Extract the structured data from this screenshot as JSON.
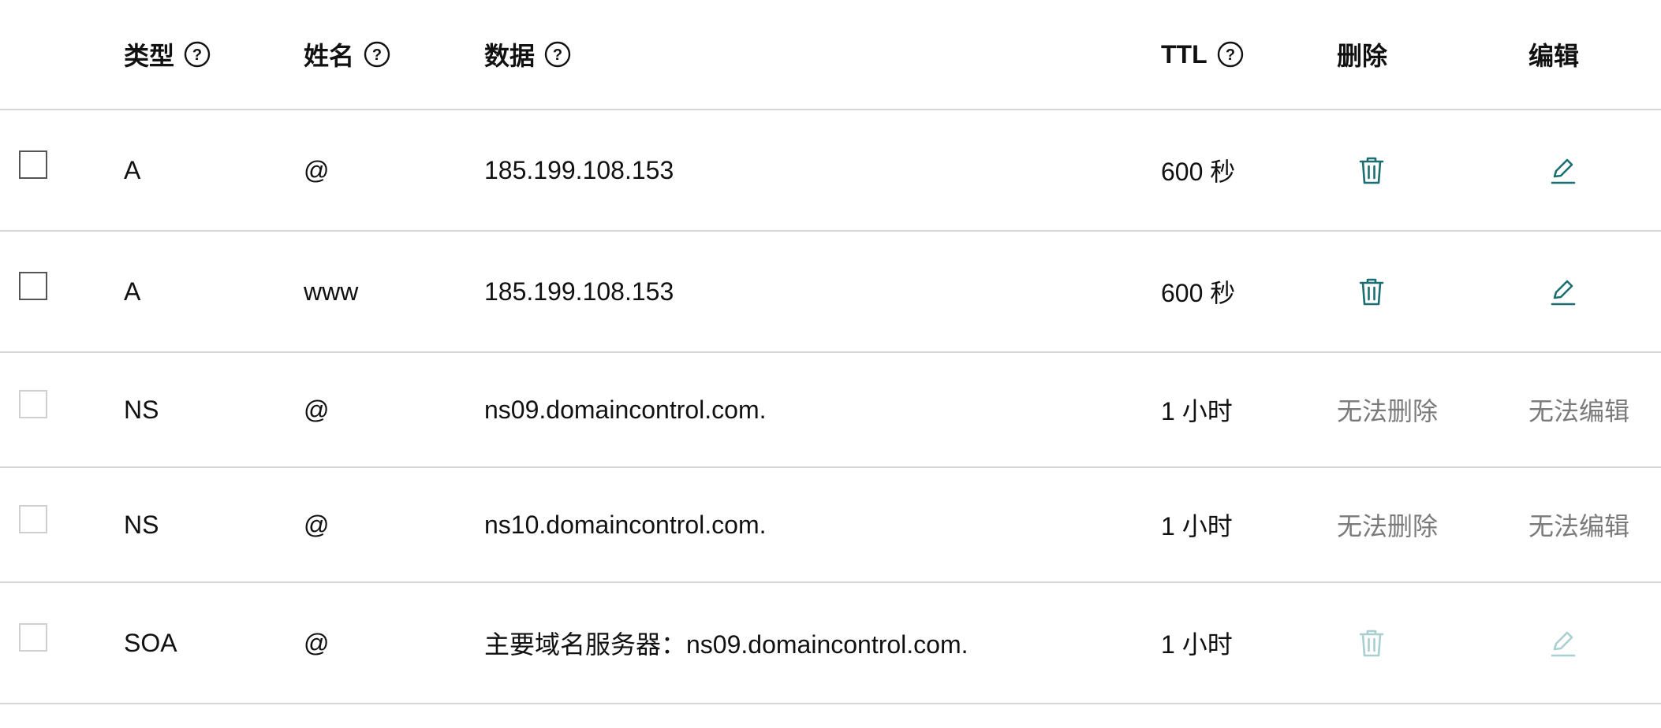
{
  "colors": {
    "accent": "#1b6e72",
    "accent_disabled": "#a9cfd0",
    "divider": "#d6d6d6",
    "disabled_text": "#7a7a7a"
  },
  "header": {
    "type": "类型",
    "name": "姓名",
    "data": "数据",
    "ttl": "TTL",
    "delete": "删除",
    "edit": "编辑"
  },
  "rows": [
    {
      "type": "A",
      "name": "@",
      "data": "185.199.108.153",
      "ttl": "600 秒",
      "delete": "trash-icon",
      "edit": "pencil-icon",
      "selectable": true,
      "editable": true
    },
    {
      "type": "A",
      "name": "www",
      "data": "185.199.108.153",
      "ttl": "600 秒",
      "delete": "trash-icon",
      "edit": "pencil-icon",
      "selectable": true,
      "editable": true
    },
    {
      "type": "NS",
      "name": "@",
      "data": "ns09.domaincontrol.com.",
      "ttl": "1 小时",
      "delete_text": "无法删除",
      "edit_text": "无法编辑",
      "selectable": false,
      "editable": false
    },
    {
      "type": "NS",
      "name": "@",
      "data": "ns10.domaincontrol.com.",
      "ttl": "1 小时",
      "delete_text": "无法删除",
      "edit_text": "无法编辑",
      "selectable": false,
      "editable": false
    },
    {
      "type": "SOA",
      "name": "@",
      "data": "主要域名服务器：ns09.domaincontrol.com.",
      "ttl": "1 小时",
      "delete": "trash-icon",
      "edit": "pencil-icon",
      "selectable": false,
      "editable": false
    }
  ]
}
